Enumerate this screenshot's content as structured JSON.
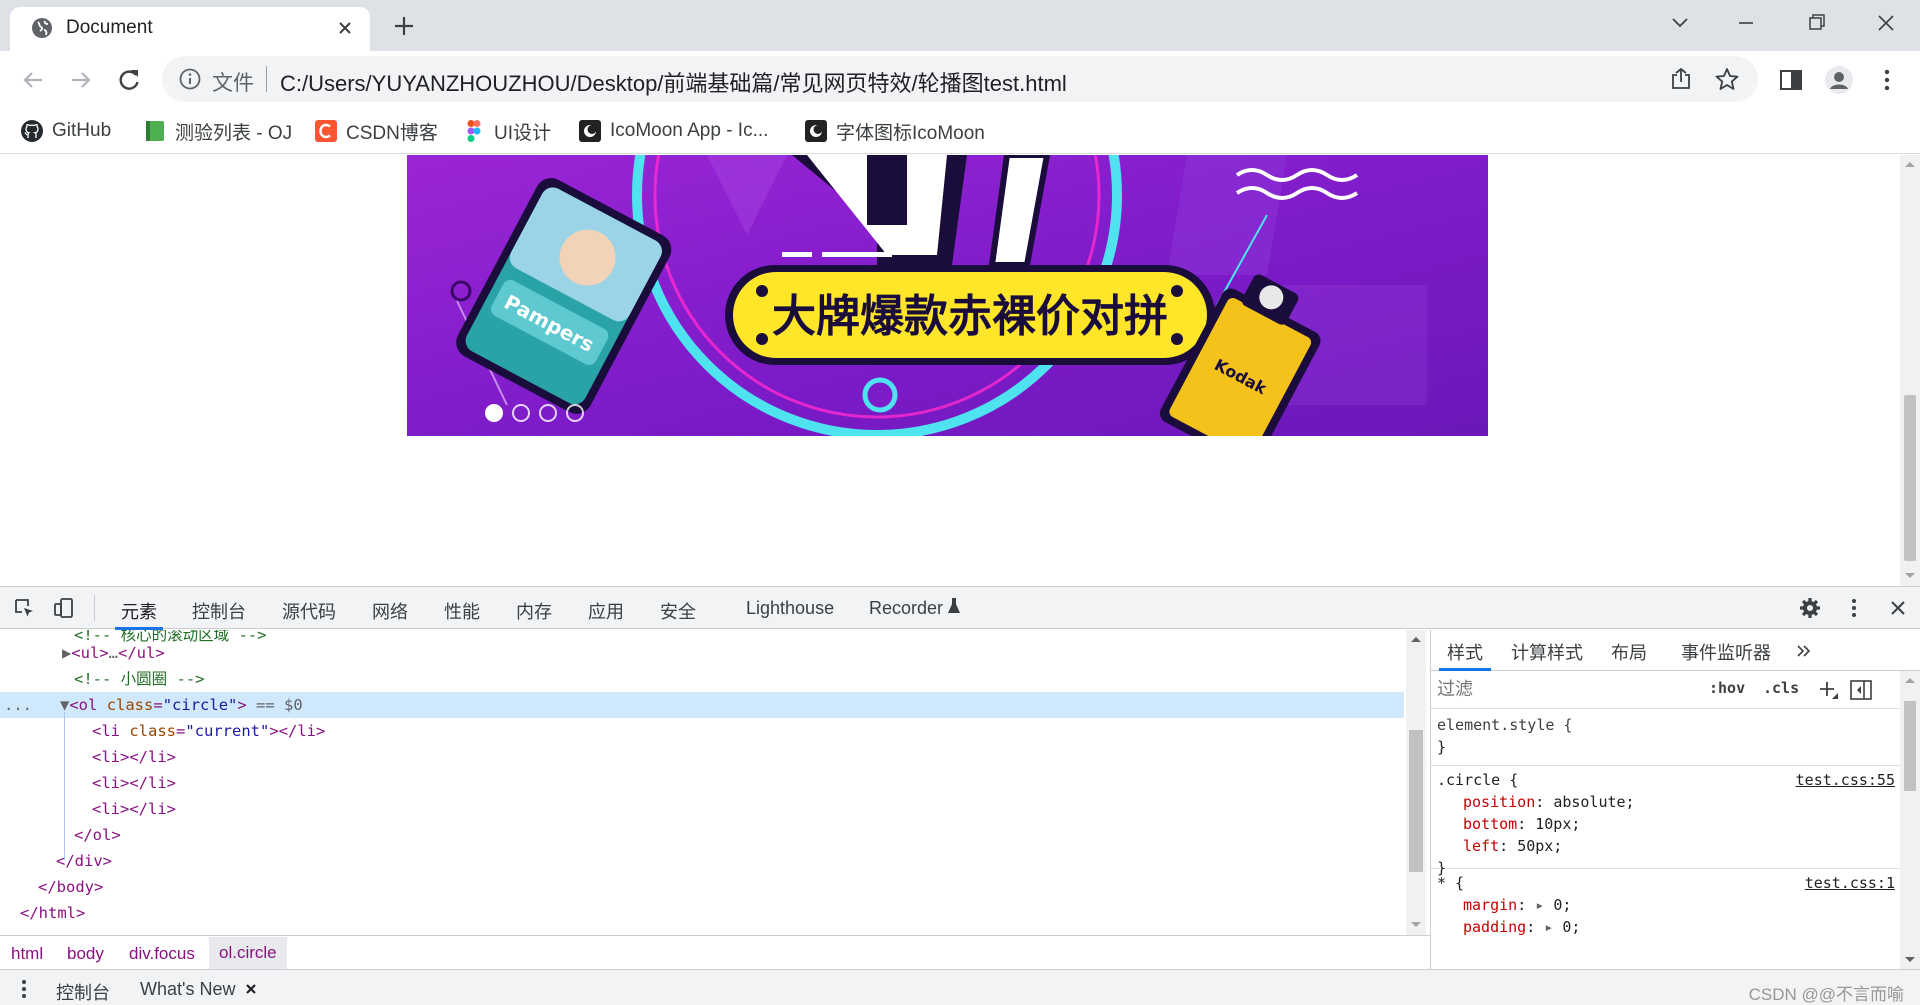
{
  "tab": {
    "title": "Document"
  },
  "omnibox": {
    "scheme_label": "文件",
    "url": "C:/Users/YUYANZHOUZHOU/Desktop/前端基础篇/常见网页特效/轮播图test.html"
  },
  "bookmarks": [
    {
      "label": "GitHub",
      "icon": "github-icon"
    },
    {
      "label": "测验列表 - OJ",
      "icon": "book-icon"
    },
    {
      "label": "CSDN博客",
      "icon": "csdn-icon"
    },
    {
      "label": "UI设计",
      "icon": "figma-icon"
    },
    {
      "label": "IcoMoon App - Ic...",
      "icon": "icomoon-icon"
    },
    {
      "label": "字体图标IcoMoon",
      "icon": "icomoon-icon"
    }
  ],
  "carousel": {
    "banner_text": "大牌爆款赤裸价对拼",
    "brand_text": "Pampers",
    "camera_text": "Kodak",
    "colors": {
      "bg": "#8a1fd0",
      "ribbon": "#ffe629",
      "ring": "#4fe3f0"
    },
    "dots": [
      {
        "current": true
      },
      {
        "current": false
      },
      {
        "current": false
      },
      {
        "current": false
      }
    ]
  },
  "devtools": {
    "tabs": [
      "元素",
      "控制台",
      "源代码",
      "网络",
      "性能",
      "内存",
      "应用",
      "安全",
      "Lighthouse",
      "Recorder"
    ],
    "active_tab": "元素",
    "code": {
      "l0": "<!-- 核心的滚动区域 -->",
      "l1_open": "<ul>",
      "l1_mid": "…",
      "l1_close": "</ul>",
      "l2": "<!-- 小圆圈 -->",
      "l3_tag": "<ol",
      "l3_attr": "class",
      "l3_val": "\"circle\"",
      "l3_end": ">",
      "l3_ref": "== $0",
      "l4_tag": "<li",
      "l4_attr": "class",
      "l4_val": "\"current\"",
      "l4_end": "></li>",
      "li": "<li></li>",
      "ol_close": "</ol>",
      "div_close": "</div>",
      "body_close": "</body>",
      "html_close": "</html>",
      "ellipsis": "..."
    },
    "breadcrumbs": [
      "html",
      "body",
      "div.focus",
      "ol.circle"
    ],
    "styles": {
      "tabs": [
        "样式",
        "计算样式",
        "布局",
        "事件监听器"
      ],
      "filter_placeholder": "过滤",
      "hov": ":hov",
      "cls": ".cls",
      "element_style": "element.style {",
      "close_brace": "}",
      "rule1_selector": ".circle {",
      "rule1_source": "test.css:55",
      "rule1_props": [
        {
          "name": "position",
          "value": "absolute;"
        },
        {
          "name": "bottom",
          "value": "10px;"
        },
        {
          "name": "left",
          "value": "50px;"
        }
      ],
      "rule2_selector": "* {",
      "rule2_source": "test.css:1",
      "rule2_props": [
        {
          "name": "margin",
          "value": "0;"
        },
        {
          "name": "padding",
          "value": "0;"
        }
      ]
    },
    "drawer": {
      "console": "控制台",
      "whats_new": "What's New"
    }
  },
  "watermark": "CSDN @@不言而喻"
}
